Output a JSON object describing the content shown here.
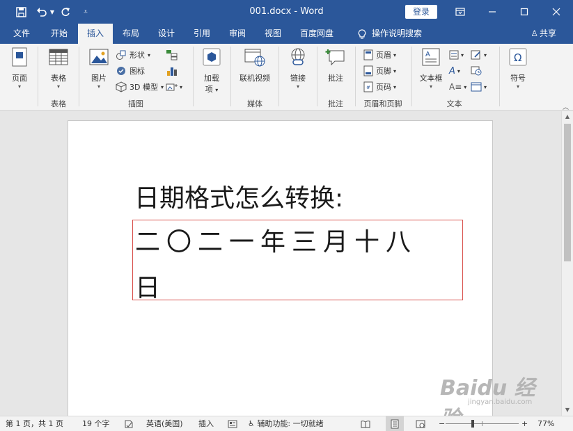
{
  "titlebar": {
    "doc_title": "001.docx  -  Word",
    "login_label": "登录",
    "colors": {
      "brand": "#2b579a"
    }
  },
  "tabs": [
    {
      "label": "文件"
    },
    {
      "label": "开始"
    },
    {
      "label": "插入",
      "active": true
    },
    {
      "label": "布局"
    },
    {
      "label": "设计"
    },
    {
      "label": "引用"
    },
    {
      "label": "审阅"
    },
    {
      "label": "视图"
    },
    {
      "label": "百度网盘"
    },
    {
      "label": "操作说明搜索"
    }
  ],
  "share_label": "共享",
  "ribbon": {
    "pages": {
      "button": "页面"
    },
    "tables": {
      "button": "表格",
      "group": "表格"
    },
    "illustrations": {
      "picture": "图片",
      "shapes": "形状",
      "icons": "图标",
      "model3d": "3D 模型",
      "group": "插图"
    },
    "addins": {
      "button_line1": "加载",
      "button_line2": "项"
    },
    "media": {
      "button": "联机视频",
      "group": "媒体"
    },
    "links": {
      "button": "链接"
    },
    "comments": {
      "button": "批注",
      "group": "批注"
    },
    "header_footer": {
      "header": "页眉",
      "footer": "页脚",
      "page_number": "页码",
      "group": "页眉和页脚"
    },
    "text": {
      "textbox": "文本框",
      "group": "文本"
    },
    "symbols": {
      "button": "符号"
    }
  },
  "document": {
    "line1": "日期格式怎么转换:",
    "line2": "二〇二一年三月十八",
    "line3": "日"
  },
  "statusbar": {
    "page_info": "第 1 页，共 1 页",
    "word_count": "19 个字",
    "language": "英语(美国)",
    "mode": "插入",
    "accessibility": "辅助功能: 一切就绪",
    "zoom": "77%",
    "zoom_level": 0.77
  },
  "watermark": {
    "logo": "Baidu 经验",
    "sub": "jingyan.baidu.com"
  }
}
